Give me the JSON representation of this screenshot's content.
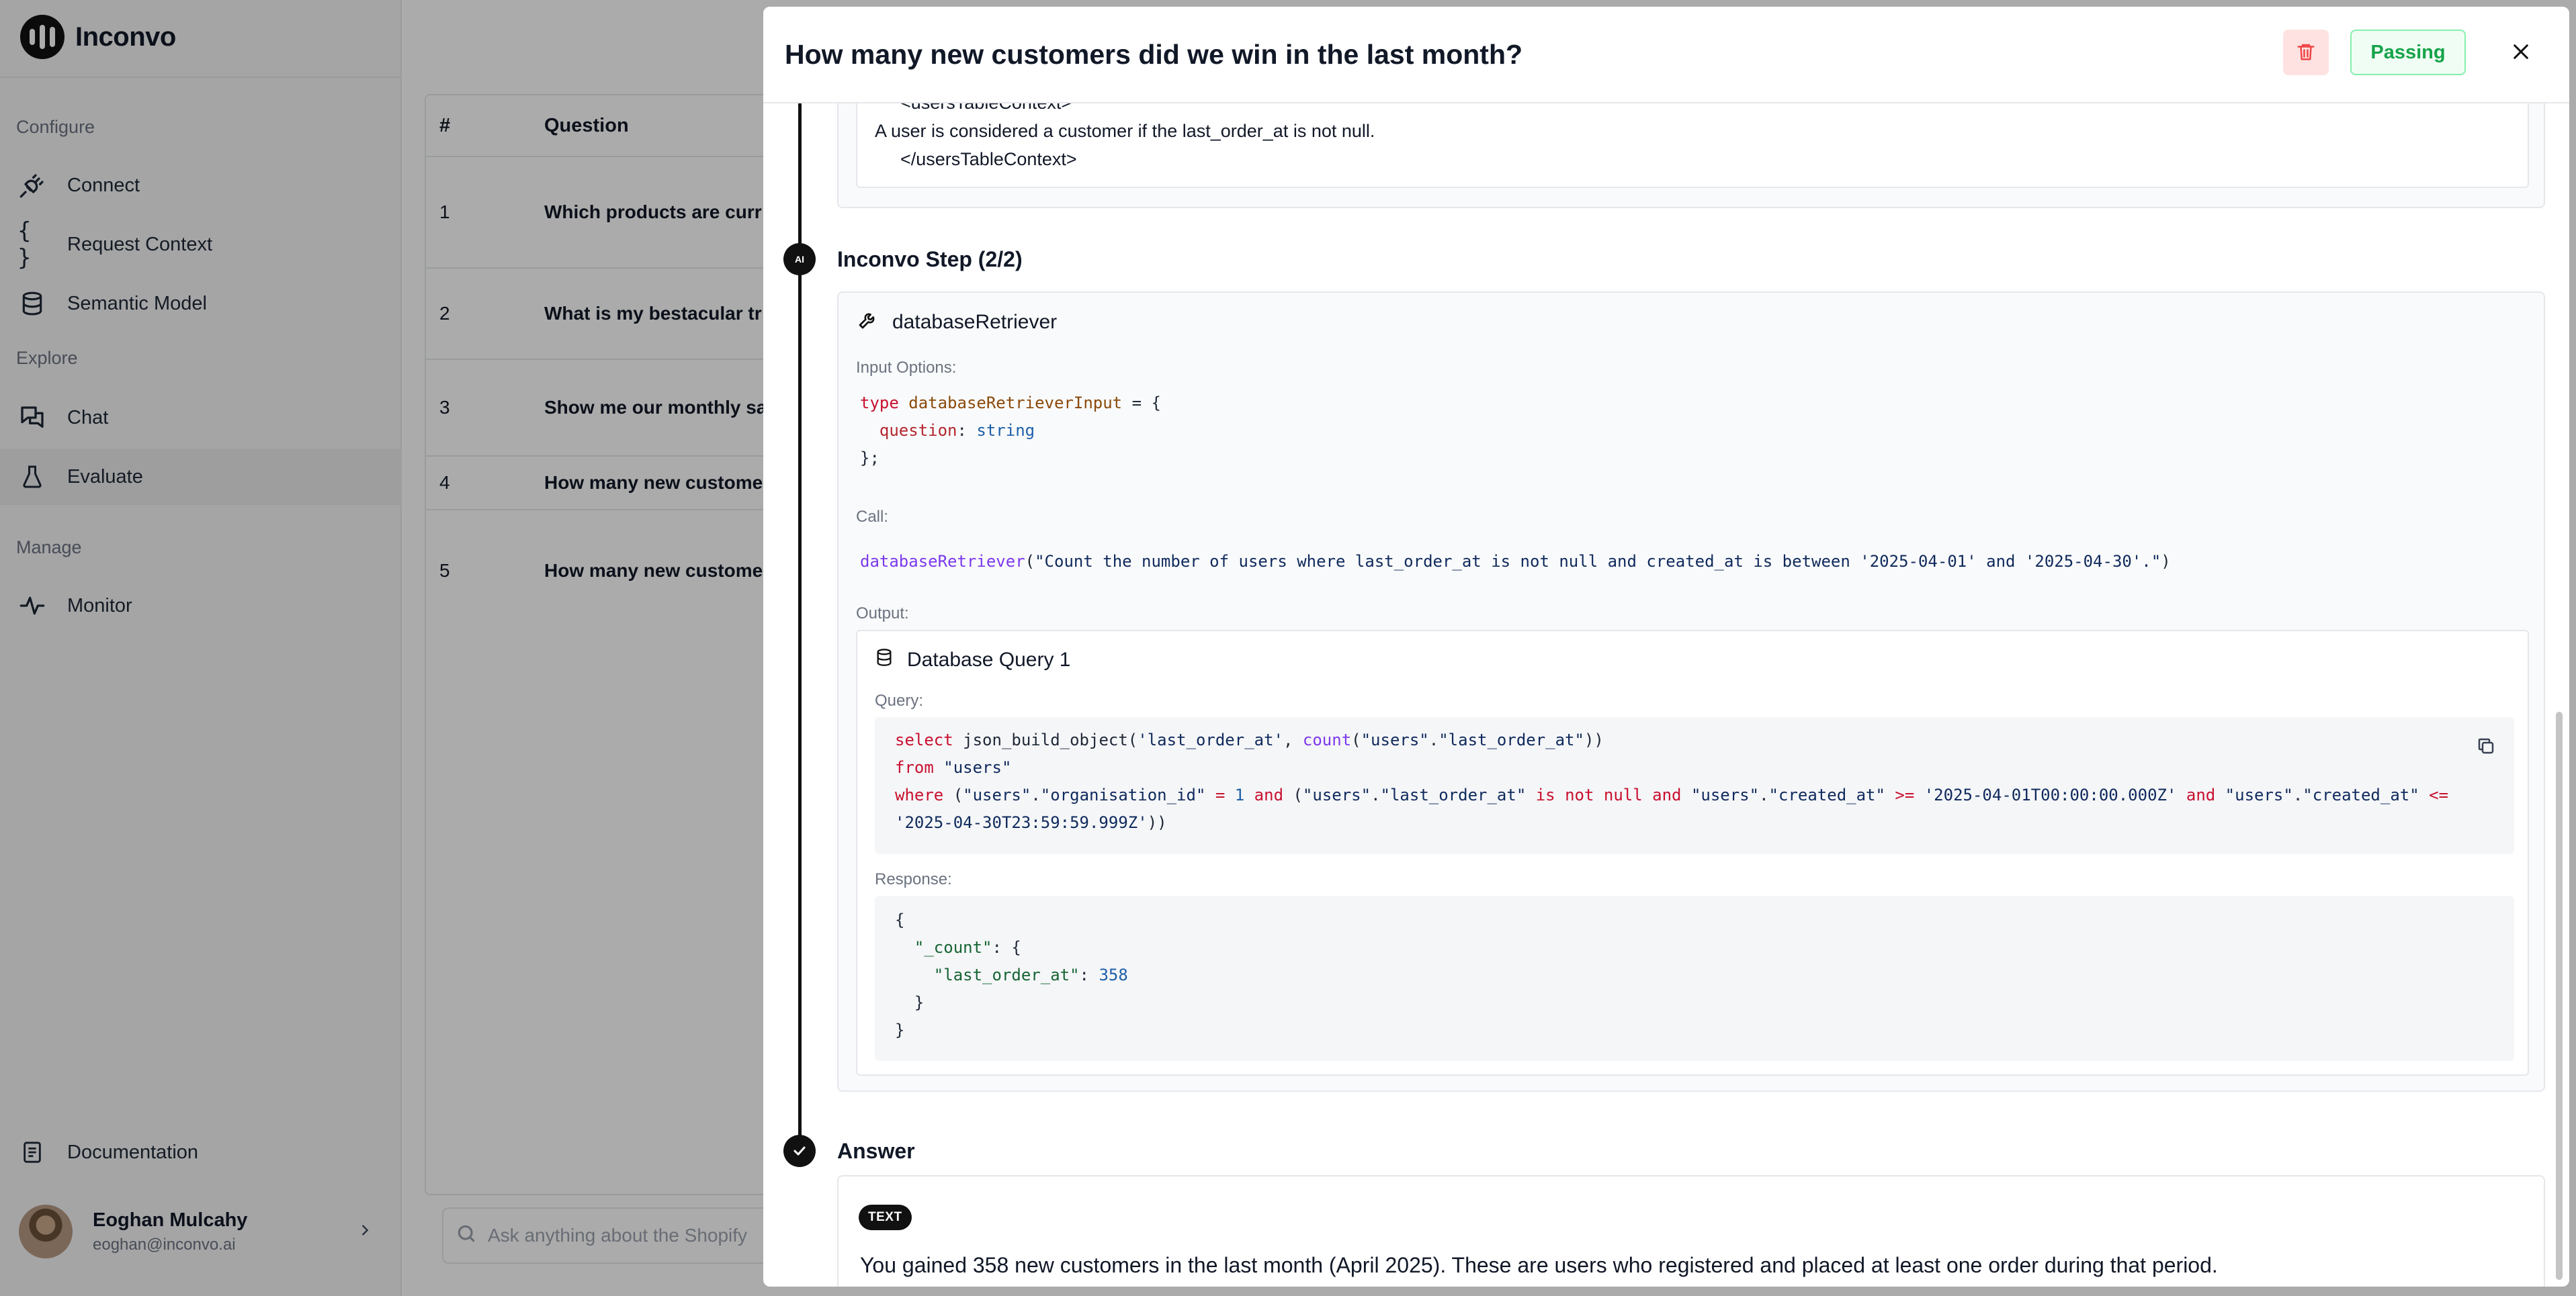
{
  "app": {
    "name": "Inconvo"
  },
  "sidebar": {
    "sections": [
      {
        "label": "Configure"
      },
      {
        "label": "Explore"
      },
      {
        "label": "Manage"
      }
    ],
    "items": [
      {
        "label": "Connect",
        "icon": "plug-icon"
      },
      {
        "label": "Request Context",
        "icon": "braces-icon"
      },
      {
        "label": "Semantic Model",
        "icon": "database-icon"
      },
      {
        "label": "Chat",
        "icon": "chat-icon"
      },
      {
        "label": "Evaluate",
        "icon": "flask-icon",
        "active": true
      },
      {
        "label": "Monitor",
        "icon": "activity-icon"
      }
    ],
    "documentation": "Documentation",
    "user": {
      "name": "Eoghan Mulcahy",
      "email": "eoghan@inconvo.ai"
    }
  },
  "table": {
    "headers": [
      "#",
      "Question"
    ],
    "rows": [
      {
        "num": "1",
        "question": "Which products are curr"
      },
      {
        "num": "2",
        "question": "What is my bestacular tr"
      },
      {
        "num": "3",
        "question": "Show me our monthly sa"
      },
      {
        "num": "4",
        "question": "How many new custome"
      },
      {
        "num": "5",
        "question": "How many new custome"
      }
    ]
  },
  "search": {
    "placeholder": "Ask anything about the Shopify"
  },
  "modal": {
    "title": "How many new customers did we win in the last month?",
    "status": "Passing",
    "context_lines": [
      "<usersTableContext>",
      "A user is considered a customer if the last_order_at is not null.",
      "</usersTableContext>"
    ],
    "step": {
      "dot_label": "AI",
      "title": "Inconvo Step (2/2)",
      "tool_name": "databaseRetriever",
      "input_label": "Input Options:",
      "input_code": {
        "kw_type": "type",
        "type_name": "databaseRetrieverInput",
        "eq": " = {",
        "prop": "question",
        "colon": ": ",
        "prop_type": "string",
        "close": "};"
      },
      "call_label": "Call:",
      "call": {
        "fn": "databaseRetriever",
        "open": "(",
        "arg": "\"Count the number of users where last_order_at is not null and created_at is between '2025-04-01' and '2025-04-30'.\"",
        "close": ")"
      },
      "output_label": "Output:",
      "output": {
        "title": "Database Query 1",
        "query_label": "Query:",
        "response_label": "Response:",
        "query": {
          "l1": {
            "select": "select",
            "fn": " json_build_object(",
            "s1": "'last_order_at'",
            "c1": ", ",
            "count": "count",
            "p1": "(",
            "s2": "\"users\"",
            "dot": ".",
            "s3": "\"last_order_at\"",
            "p2": "))"
          },
          "l2": {
            "from": "from",
            "sp": " ",
            "tbl": "\"users\""
          },
          "l3": {
            "where": "where",
            "p1": " (",
            "s1": "\"users\"",
            "d1": ".",
            "s2": "\"organisation_id\"",
            "eq": " = ",
            "one": "1",
            "and1": " and ",
            "p2": "(",
            "s3": "\"users\"",
            "d2": ".",
            "s4": "\"last_order_at\"",
            "isnn": " is not null ",
            "and2": "and",
            "sp": " ",
            "s5": "\"users\"",
            "d3": ".",
            "s6": "\"created_at\"",
            "gte": " >= ",
            "d_from": "'2025-04-01T00:00:00.000Z'",
            "and3": " and ",
            "s7": "\"users\"",
            "d4": ".",
            "s8": "\"created_at\"",
            "lte": " <="
          },
          "l4": {
            "d_to": "'2025-04-30T23:59:59.999Z'",
            "close": "))"
          }
        },
        "response": {
          "open": "{",
          "key1": "\"_count\"",
          "colon1": ": {",
          "key2": "\"last_order_at\"",
          "colon2": ": ",
          "value": "358",
          "inner_close": "}",
          "close": "}"
        }
      }
    },
    "answer": {
      "title": "Answer",
      "badge": "TEXT",
      "text": "You gained 358 new customers in the last month (April 2025). These are users who registered and placed at least one order during that period."
    }
  },
  "colors": {
    "passing_green": "#16a34a",
    "delete_red": "#ef4444",
    "accent_dark": "#111111"
  }
}
